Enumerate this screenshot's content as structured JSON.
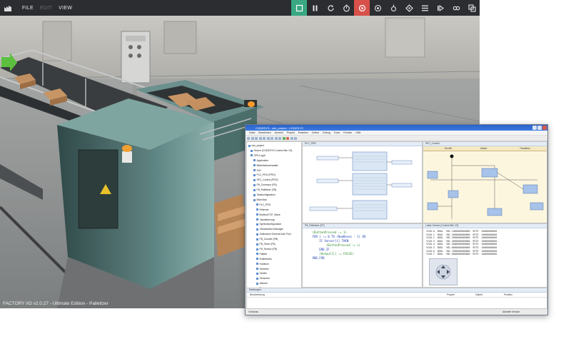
{
  "app": {
    "menu": {
      "file": "FILE",
      "edit": "EDIT",
      "view": "VIEW"
    },
    "toolbar_icons": [
      "select-icon",
      "pause-icon",
      "reset-icon",
      "timer-icon",
      "run-icon",
      "camera-icon",
      "light-icon",
      "drivers-icon",
      "list-icon",
      "sensor-icon",
      "link-icon",
      "layers-icon"
    ],
    "status": "FACTORY I/O v2.0.27 - Ultimate Edition - Palletizer",
    "colors": {
      "topbar": "#2b2d30",
      "active_green": "#3aa883",
      "active_red": "#d8504a"
    }
  },
  "ide": {
    "title": "CODESYS - sim_project - CODESYS",
    "menu": [
      "Datei",
      "Bearbeiten",
      "Ansicht",
      "Projekt",
      "Erstellen",
      "Online",
      "Debug",
      "Tools",
      "Fenster",
      "Hilfe"
    ],
    "tree_items": [
      "sim_project",
      "Device (CODESYS Control Win V3)",
      "SPS-Logik",
      "Application",
      "Bibliotheksverwalter",
      "GVL",
      "PLC_PRG (PRG)",
      "SFC_Control (PRG)",
      "FB_Conveyor (FB)",
      "FB_Palletizer (FB)",
      "Taskkonfiguration",
      "MainTask",
      "PLC_PRG",
      "Ethernet",
      "ModbusTCP_Slave",
      "Visualisierung",
      "Symbolkonfiguration",
      "Visualization Manager",
      "Softmotion General Axis Pool",
      "FB_Counter (FB)",
      "FB_Timer (FB)",
      "FB_Sensor (FB)",
      "Palette",
      "Rollenbahn",
      "Hubtisch",
      "Schieber",
      "Greifer",
      "Sensoren",
      "Aktoren",
      "Diagnose"
    ],
    "fbd_tab": "PLC_PRG",
    "sfc_tab": "SFC_Control",
    "sfc_header": [
      "Schritt",
      "Aktion",
      "Transition"
    ],
    "st_tab": "FB_Palletizer (ST)",
    "st_lines": [
      "    (ButtonPressed := 1)",
      "    FOR i := 0 TO (NumBoxes - 1) DO",
      "        IF Sensor[i] THEN",
      "            (ButtonPressed := i)",
      "        END_IF",
      "        (Output[i] := FALSE)",
      "    END_FOR"
    ],
    "watch_tab": "Lokal: Device (Control Win V3)",
    "watch_lines": [
      "%IX0.0  BOOL  %B1.1000000000000  BYTE  16#00000000",
      "%IX0.1  BOOL  %B1.2000000000000  BYTE  16#00000000",
      "%IX0.2  BOOL  %B1.3000000000000  BYTE  16#00000000",
      "%IX0.3  BOOL  %B1.4000000000000  BYTE  16#00000000",
      "%IX0.4  BOOL  %B1.5000000000000  BYTE  16#00000000",
      "%IX0.5  BOOL  %B1.6000000000000  BYTE  16#00000000",
      "%IX0.6  BOOL  %B1.7000000000000  BYTE  16#00000000",
      "%IX0.7  BOOL  %B1.8000000000000  BYTE  16#00000000"
    ],
    "msg_tab": "Meldungen",
    "msg_header": [
      "Beschreibung",
      "Projekt",
      "Objekt",
      "Position"
    ],
    "status_left": "Vorschau",
    "status_right": "Aktuelle Version"
  }
}
